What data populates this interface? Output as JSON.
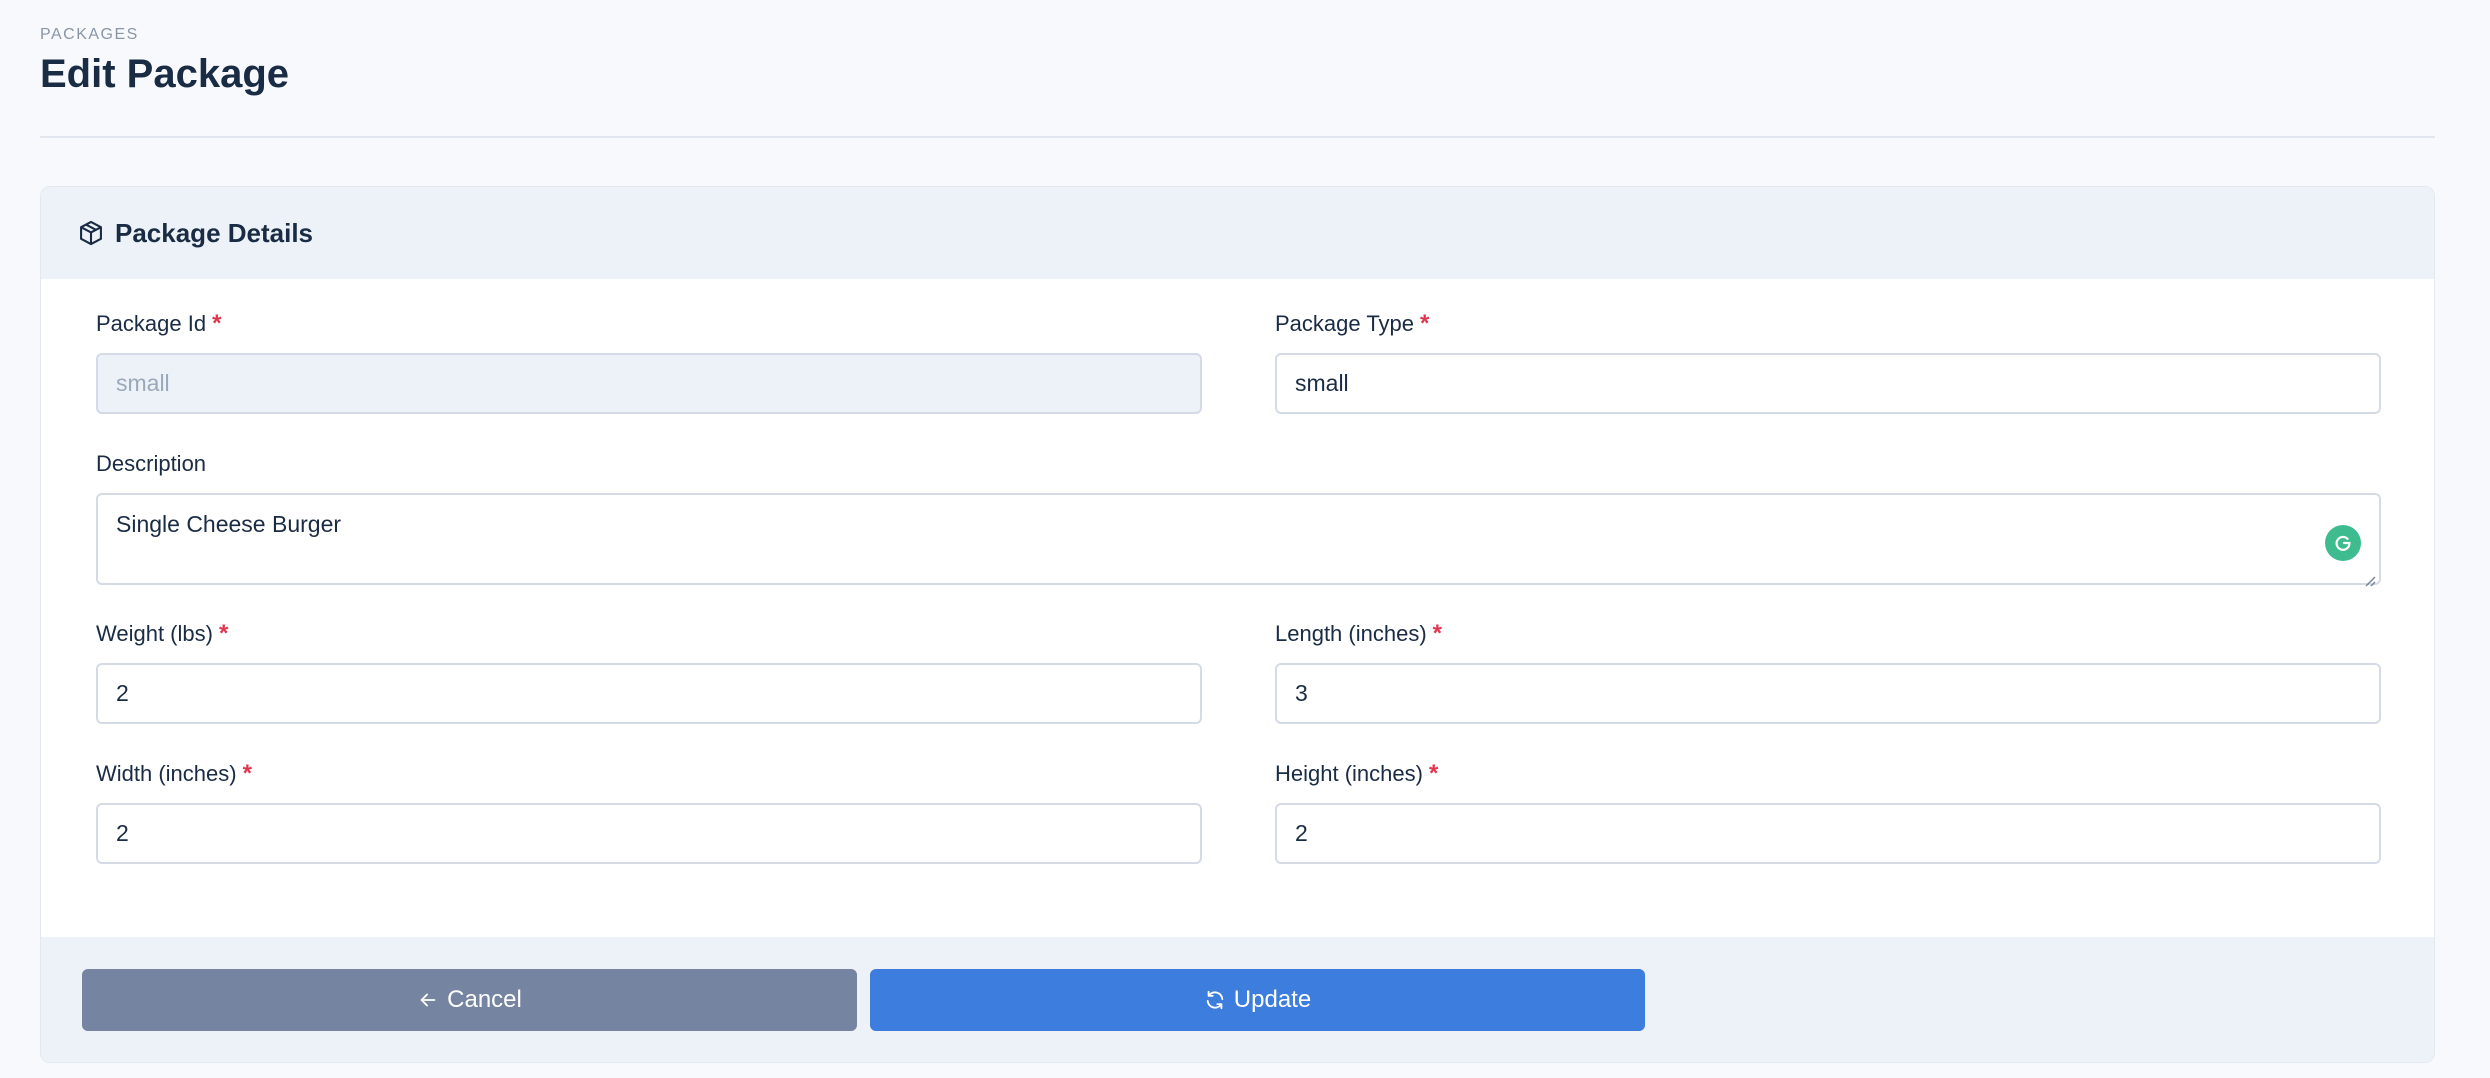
{
  "header": {
    "eyebrow": "PACKAGES",
    "title": "Edit Package"
  },
  "card": {
    "title": "Package Details",
    "icon": "package-box-icon"
  },
  "form": {
    "package_id": {
      "label": "Package Id",
      "value": "small",
      "required": true,
      "disabled": true
    },
    "package_type": {
      "label": "Package Type",
      "value": "small",
      "required": true
    },
    "description": {
      "label": "Description",
      "value": "Single Cheese Burger",
      "required": false
    },
    "weight": {
      "label": "Weight (lbs)",
      "value": "2",
      "required": true
    },
    "length": {
      "label": "Length (inches)",
      "value": "3",
      "required": true
    },
    "width": {
      "label": "Width (inches)",
      "value": "2",
      "required": true
    },
    "height": {
      "label": "Height (inches)",
      "value": "2",
      "required": true
    },
    "required_marker": "*"
  },
  "actions": {
    "cancel_label": "Cancel",
    "update_label": "Update"
  },
  "colors": {
    "accent": "#3d7ddd",
    "cancel": "#7584a0",
    "required": "#e0364f",
    "grammarly": "#3ebc8f"
  }
}
